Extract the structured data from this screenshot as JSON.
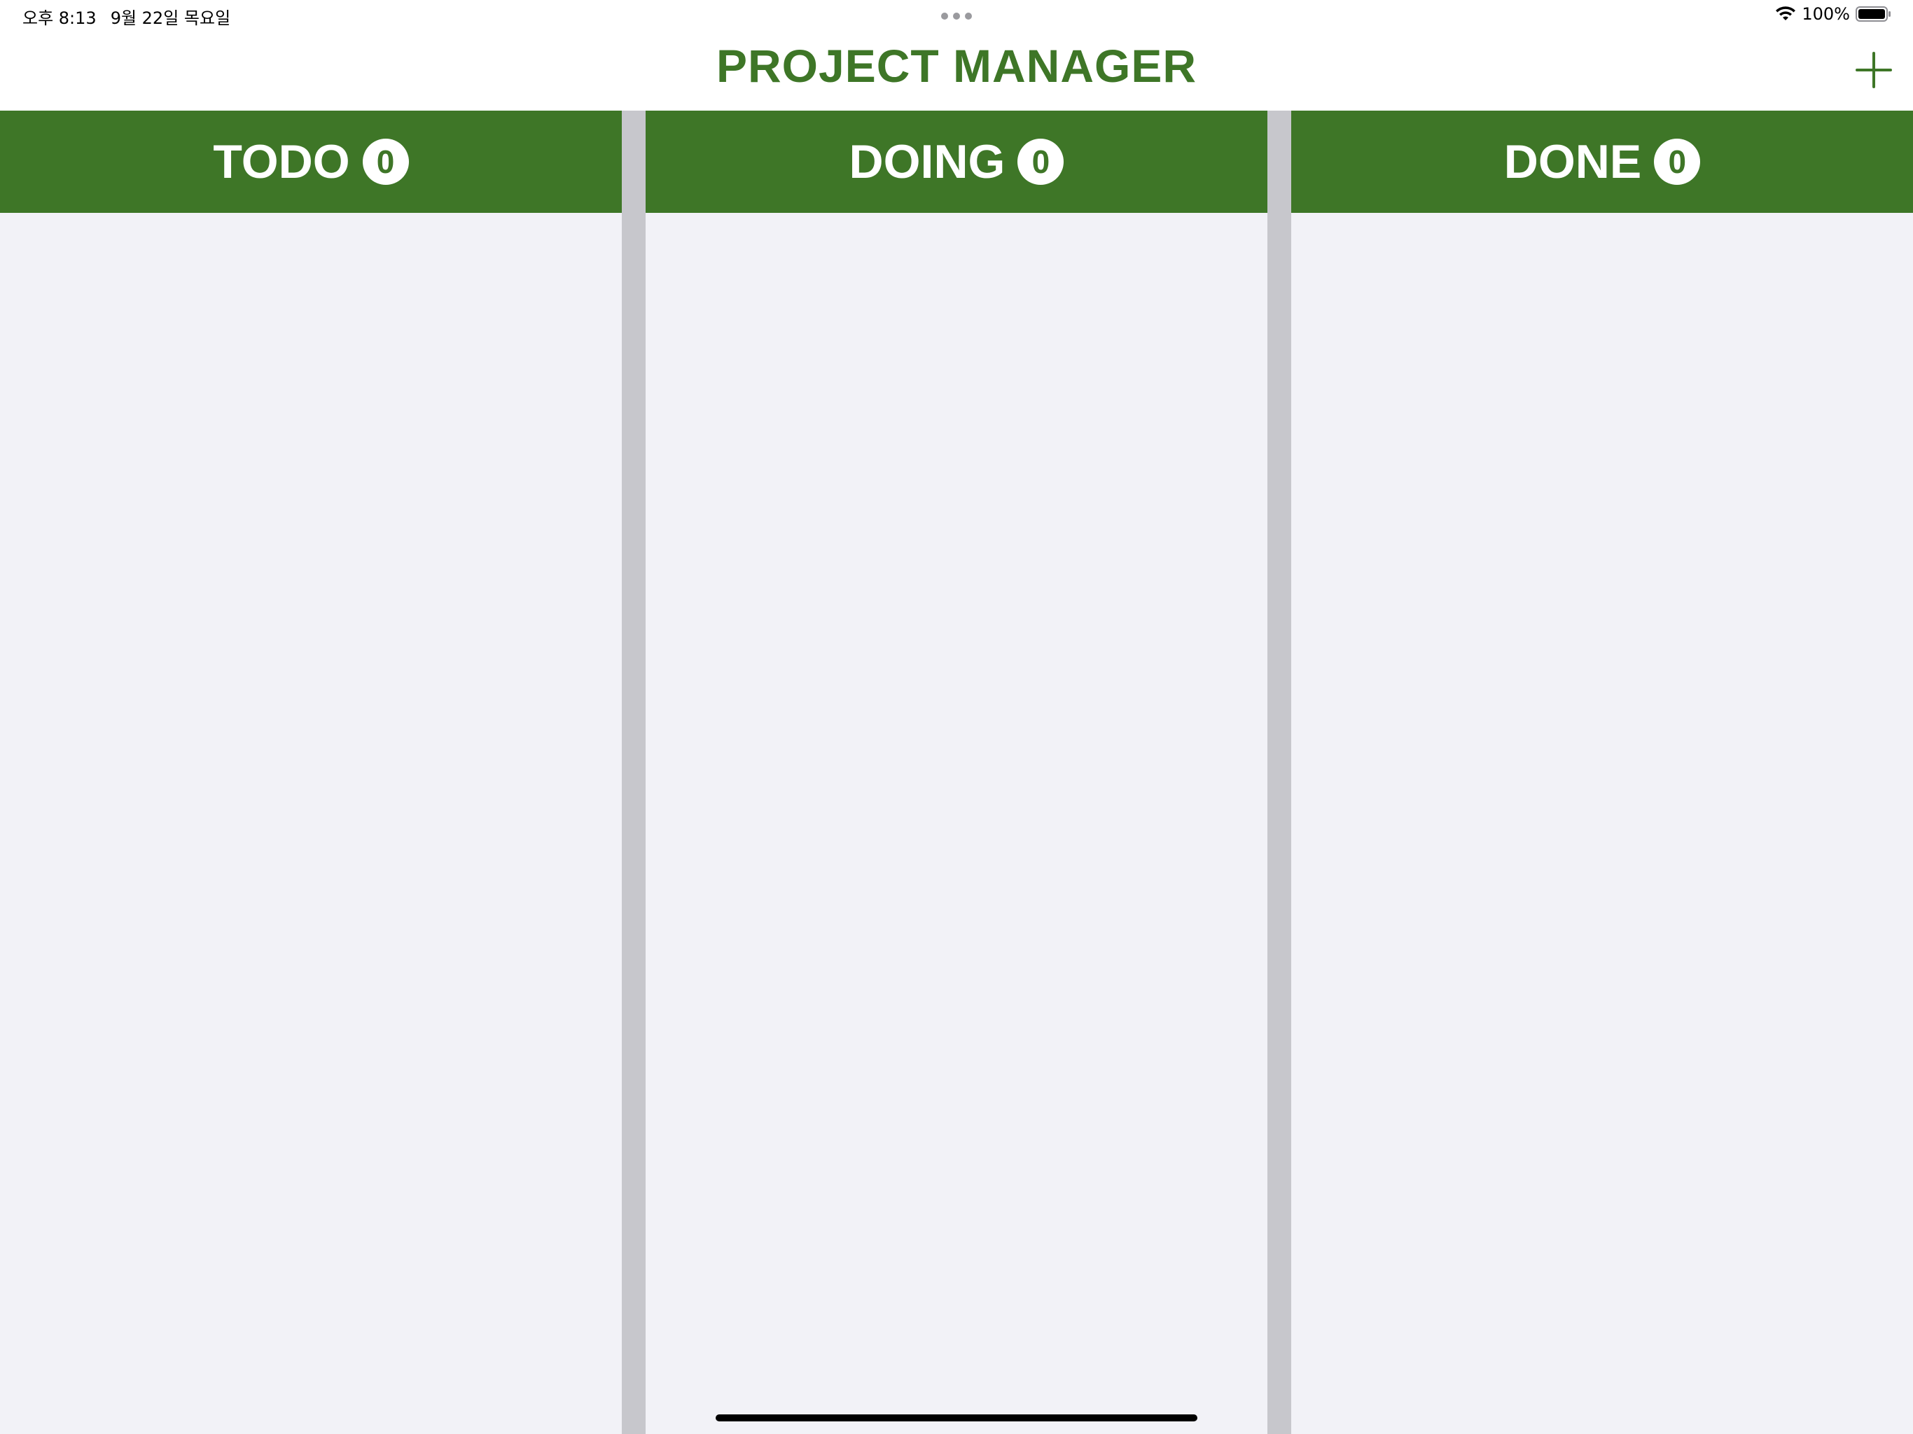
{
  "status_bar": {
    "time": "오후 8:13",
    "date": "9월 22일 목요일",
    "battery_percent": "100%",
    "battery_level": 1.0,
    "wifi_icon": "wifi-icon",
    "battery_icon": "battery-icon"
  },
  "nav": {
    "title": "PROJECT MANAGER",
    "add_icon": "plus-icon"
  },
  "columns": [
    {
      "title": "TODO",
      "count": "0"
    },
    {
      "title": "DOING",
      "count": "0"
    },
    {
      "title": "DONE",
      "count": "0"
    }
  ],
  "colors": {
    "accent": "#3e7627",
    "column_background": "#f2f2f7",
    "divider": "#c7c7cc"
  }
}
